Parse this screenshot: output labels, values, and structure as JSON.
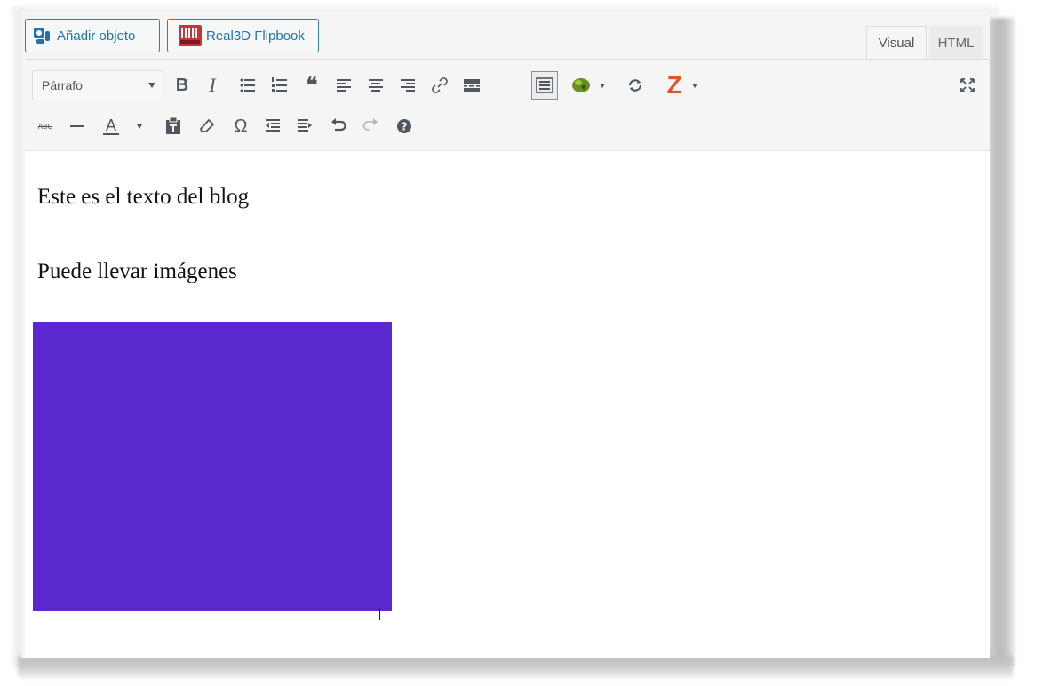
{
  "media_buttons": {
    "add_object_label": "Añadir objeto",
    "flipbook_label": "Real3D Flipbook"
  },
  "tabs": {
    "visual_label": "Visual",
    "html_label": "HTML",
    "active": "Visual"
  },
  "toolbar": {
    "format_select_value": "Párrafo",
    "row1_icons": [
      "bold-icon",
      "italic-icon",
      "bulleted-list-icon",
      "numbered-list-icon",
      "blockquote-icon",
      "align-left-icon",
      "align-center-icon",
      "align-right-icon",
      "link-icon",
      "read-more-icon",
      "toolbar-toggle-icon",
      "plugin-dropdown-icon",
      "refresh-icon",
      "z-dropdown-icon",
      "fullscreen-icon"
    ],
    "row2_icons": [
      "strikethrough-icon",
      "horizontal-line-icon",
      "text-color-icon",
      "paste-text-icon",
      "clear-formatting-icon",
      "special-character-icon",
      "decrease-indent-icon",
      "increase-indent-icon",
      "undo-icon",
      "redo-icon",
      "help-icon"
    ],
    "bold_glyph": "B",
    "italic_glyph": "I",
    "text_color_glyph": "A",
    "omega_glyph": "Ω",
    "strike_glyph": "ABC",
    "z_glyph": "Z"
  },
  "colors": {
    "accent_blue": "#2271b1",
    "image_fill": "#5b27cf",
    "z_orange": "#e0542a",
    "editor_bg": "#f5f5f5"
  },
  "content": {
    "paragraph_1": "Este es el texto del blog",
    "paragraph_2": "Puede llevar imágenes"
  }
}
